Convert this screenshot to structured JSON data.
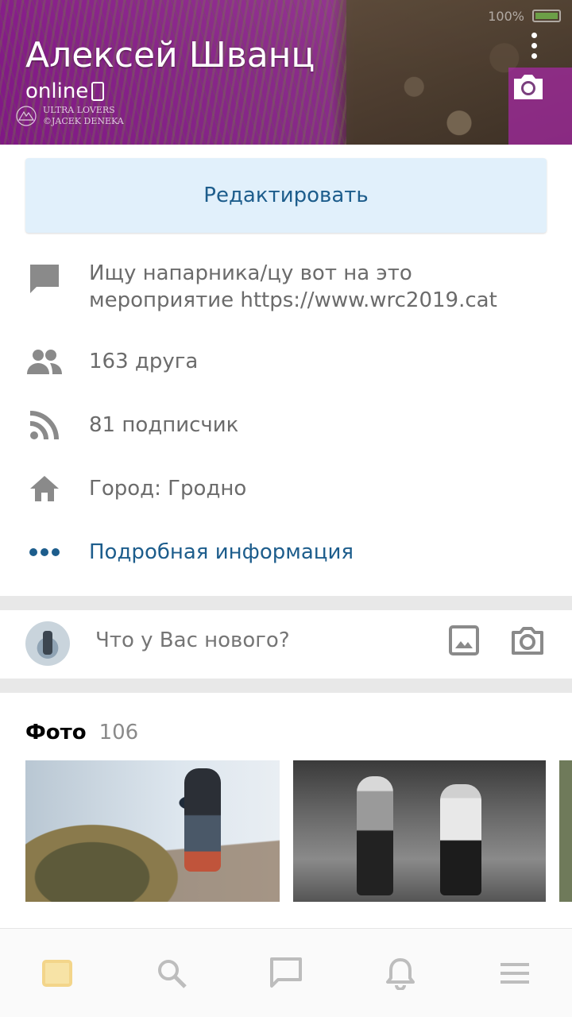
{
  "status_bar": {
    "battery_text": "100%"
  },
  "profile": {
    "name": "Алексей Шванц",
    "status": "online",
    "watermark_line1": "ULTRA LOVERS",
    "watermark_line2": "©JACEK DENEKA"
  },
  "info": {
    "edit_label": "Редактировать",
    "status_text": "Ищу напарника/цу вот на это мероприятие https://www.wrc2019.cat",
    "friends": "163 друга",
    "followers": "81 подписчик",
    "city": "Город: Гродно",
    "more_info": "Подробная информация"
  },
  "composer": {
    "placeholder": "Что у Вас нового?"
  },
  "photos": {
    "title": "Фото",
    "count": "106"
  },
  "colors": {
    "accent": "#1d5d8c",
    "edit_button_bg": "#e1f0fb",
    "icon_gray": "#8a8a8a",
    "nav_active": "#f7e3a6"
  },
  "icons": {
    "status": "chat-bubble-icon",
    "friends": "people-icon",
    "followers": "rss-icon",
    "city": "home-icon",
    "more": "more-horizontal-icon",
    "composer_photo": "image-icon",
    "composer_camera": "camera-icon",
    "nav": [
      "news-icon",
      "search-icon",
      "messages-icon",
      "notifications-icon",
      "menu-icon"
    ]
  }
}
